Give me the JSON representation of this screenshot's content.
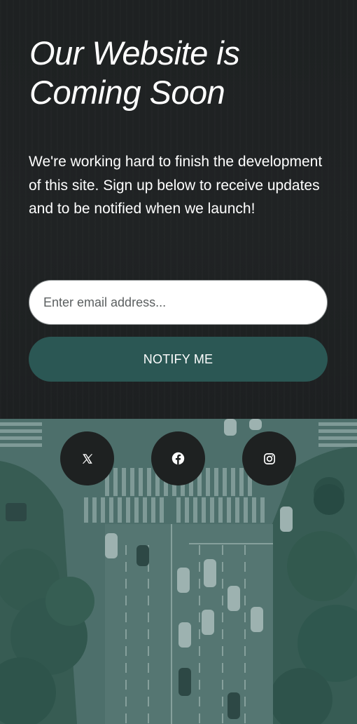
{
  "hero": {
    "headline_line1": "Our Website is",
    "headline_line2": "Coming Soon",
    "description": "We're working hard to finish the development of this site. Sign up below to receive updates and to be notified when we launch!"
  },
  "signup": {
    "email_placeholder": "Enter email address...",
    "email_value": "",
    "notify_label": "NOTIFY ME"
  },
  "social": [
    {
      "icon": "x-twitter-icon",
      "label": "X"
    },
    {
      "icon": "facebook-icon",
      "label": "Facebook"
    },
    {
      "icon": "instagram-icon",
      "label": "Instagram"
    }
  ],
  "colors": {
    "background_dark": "#1f2223",
    "accent_teal": "#2b5754",
    "text_white": "#ffffff",
    "social_button_bg": "#1e2121"
  }
}
